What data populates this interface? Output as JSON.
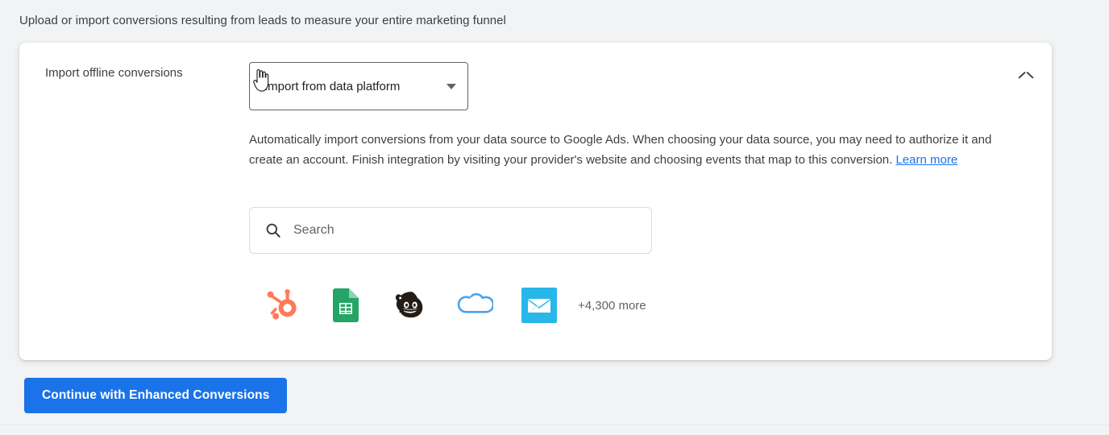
{
  "page": {
    "intro_text": "Upload or import conversions resulting from leads to measure your entire marketing funnel",
    "background_color": "#f1f3f4"
  },
  "card": {
    "title": "Import offline conversions",
    "collapse_icon": "chevron-up-icon",
    "method_select": {
      "value": "Import from data platform",
      "caret_icon": "caret-down-icon"
    },
    "description": {
      "text": "Automatically import conversions from your data source to Google Ads. When choosing your data source, you may need to authorize it and create an account. Finish integration by visiting your provider's website and choosing events that map to this conversion. ",
      "link_label": "Learn more",
      "link_color": "#1a73e8"
    },
    "search": {
      "icon": "search-icon",
      "placeholder": "Search",
      "value": ""
    },
    "platforms": [
      {
        "name": "hubspot",
        "icon": "hubspot-icon",
        "color": "#ff7a59"
      },
      {
        "name": "google-sheets",
        "icon": "google-sheets-icon",
        "color": "#23a566"
      },
      {
        "name": "mailchimp",
        "icon": "mailchimp-icon",
        "color": "#241c15"
      },
      {
        "name": "salesforce",
        "icon": "salesforce-cloud-icon",
        "color": "#4aa3ea"
      },
      {
        "name": "campaign-monitor",
        "icon": "envelope-square-icon",
        "color": "#29b6e8"
      }
    ],
    "more_platforms_label": "+4,300 more"
  },
  "footer": {
    "primary_button": {
      "label": "Continue with Enhanced Conversions",
      "color": "#1a73e8"
    }
  },
  "cursor": {
    "type": "pointer-hand-cursor"
  }
}
